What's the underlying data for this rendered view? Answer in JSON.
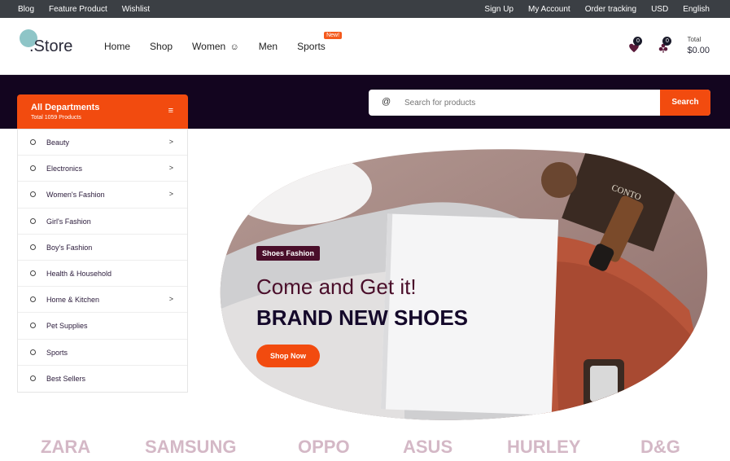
{
  "topbar": {
    "left_links": [
      "Blog",
      "Feature Product",
      "Wishlist"
    ],
    "right_links": [
      "Sign Up",
      "My Account",
      "Order tracking",
      "USD",
      "English"
    ]
  },
  "logo": {
    "text": ".Store"
  },
  "nav": {
    "items": [
      "Home",
      "Shop",
      "Women",
      "Men",
      "Sports"
    ],
    "women_icon": "☺",
    "sports_badge": "New!"
  },
  "header_icons": {
    "wishlist_count": "0",
    "cart_count": "0",
    "cart_label": "Total",
    "cart_amount": "$0.00"
  },
  "search": {
    "at_symbol": "@",
    "placeholder": "Search for products",
    "button": "Search"
  },
  "departments": {
    "title": "All Departments",
    "subtitle": "Total 1059 Products",
    "menu_icon": "≡",
    "items": [
      {
        "label": "Beauty",
        "has_sub": true
      },
      {
        "label": "Electronics",
        "has_sub": true
      },
      {
        "label": "Women's Fashion",
        "has_sub": true
      },
      {
        "label": "Girl's Fashion",
        "has_sub": false
      },
      {
        "label": "Boy's Fashion",
        "has_sub": false
      },
      {
        "label": "Health & Household",
        "has_sub": false
      },
      {
        "label": "Home & Kitchen",
        "has_sub": true
      },
      {
        "label": "Pet Supplies",
        "has_sub": false
      },
      {
        "label": "Sports",
        "has_sub": false
      },
      {
        "label": "Best Sellers",
        "has_sub": false
      }
    ],
    "arrow": ">"
  },
  "hero": {
    "tag": "Shoes Fashion",
    "headline": "Come and Get it!",
    "subheadline": "BRAND NEW SHOES",
    "button": "Shop Now",
    "book_label": "CONTO"
  },
  "brands": [
    "ZARA",
    "SAMSUNG",
    "OPPO",
    "ASUS",
    "HURLEY",
    "D&G"
  ],
  "colors": {
    "accent": "#f24b0f",
    "dark_band": "#13051f",
    "topbar": "#3b3f44",
    "tag_bg": "#4a0e2a"
  }
}
